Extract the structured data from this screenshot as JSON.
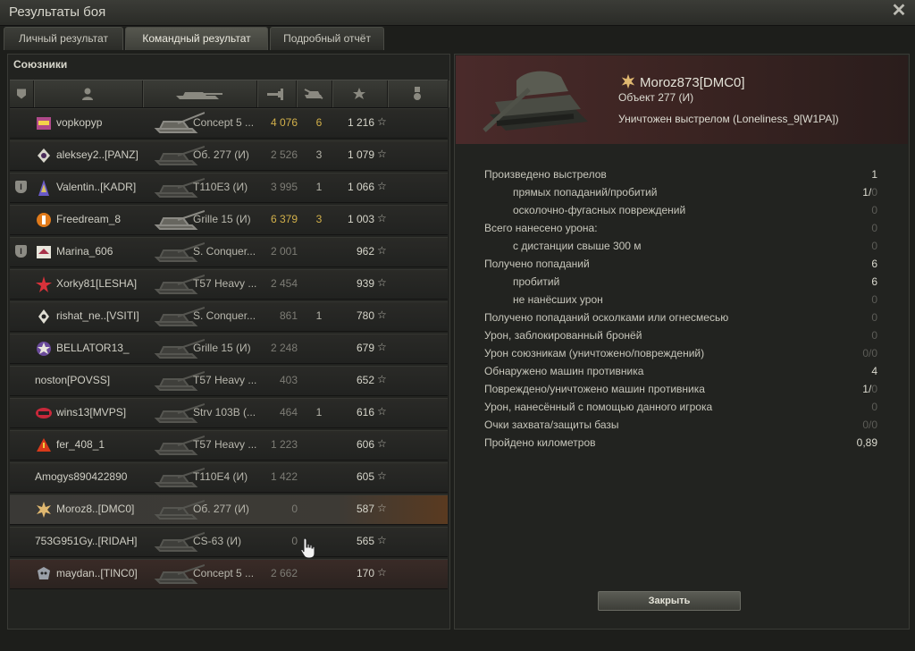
{
  "window": {
    "title": "Результаты боя"
  },
  "tabs": [
    {
      "label": "Личный результат"
    },
    {
      "label": "Командный результат"
    },
    {
      "label": "Подробный отчёт"
    }
  ],
  "allies": {
    "label": "Союзники",
    "rows": [
      {
        "player": "vopkopyp",
        "vehicle": "Concept 5 ...",
        "damage": "4 076",
        "kills": "6",
        "xp": "1 216",
        "star": "☆"
      },
      {
        "player": "aleksey2..[PANZ]",
        "vehicle": "Об. 277 (И)",
        "damage": "2 526",
        "kills": "3",
        "xp": "1 079",
        "star": "☆"
      },
      {
        "player": "Valentin..[KADR]",
        "vehicle": "T110E3 (И)",
        "damage": "3 995",
        "kills": "1",
        "xp": "1 066",
        "star": "☆"
      },
      {
        "player": "Freedream_8",
        "vehicle": "Grille 15 (И)",
        "damage": "6 379",
        "kills": "3",
        "xp": "1 003",
        "star": "☆"
      },
      {
        "player": "Marina_606",
        "vehicle": "S. Conquer...",
        "damage": "2 001",
        "kills": "",
        "xp": "962",
        "star": "☆"
      },
      {
        "player": "Xorky81[LESHA]",
        "vehicle": "T57 Heavy ...",
        "damage": "2 454",
        "kills": "",
        "xp": "939",
        "star": "☆"
      },
      {
        "player": "rishat_ne..[VSITI]",
        "vehicle": "S. Conquer...",
        "damage": "861",
        "kills": "1",
        "xp": "780",
        "star": "☆"
      },
      {
        "player": "BELLATOR13_",
        "vehicle": "Grille 15 (И)",
        "damage": "2 248",
        "kills": "",
        "xp": "679",
        "star": "☆"
      },
      {
        "player": "noston[POVSS]",
        "vehicle": "T57 Heavy ...",
        "damage": "403",
        "kills": "",
        "xp": "652",
        "star": "☆"
      },
      {
        "player": "wins13[MVPS]",
        "vehicle": "Strv 103B (...",
        "damage": "464",
        "kills": "1",
        "xp": "616",
        "star": "☆"
      },
      {
        "player": "fer_408_1",
        "vehicle": "T57 Heavy ...",
        "damage": "1 223",
        "kills": "",
        "xp": "606",
        "star": "☆"
      },
      {
        "player": "Amogys890422890",
        "vehicle": "T110E4 (И)",
        "damage": "1 422",
        "kills": "",
        "xp": "605",
        "star": "☆"
      },
      {
        "player": "Moroz8..[DMC0]",
        "vehicle": "Об. 277 (И)",
        "damage": "0",
        "kills": "",
        "xp": "587",
        "star": "☆"
      },
      {
        "player": "753G951Gy..[RIDAH]",
        "vehicle": "CS-63 (И)",
        "damage": "0",
        "kills": "",
        "xp": "565",
        "star": "☆"
      },
      {
        "player": "maydan..[TINC0]",
        "vehicle": "Concept 5 ...",
        "damage": "2 662",
        "kills": "",
        "xp": "170",
        "star": "☆"
      }
    ]
  },
  "detail": {
    "player": "Moroz873[DMC0]",
    "vehicle": "Объект 277 (И)",
    "destroyed_by": "Уничтожен выстрелом (Loneliness_9[W1PA])",
    "stats": [
      {
        "label": "Произведено выстрелов",
        "value": "1"
      },
      {
        "label": "прямых попаданий/пробитий",
        "value": "1/",
        "value2": "0"
      },
      {
        "label": "осколочно-фугасных повреждений",
        "value": "0"
      },
      {
        "label": "Всего нанесено урона:",
        "value": "0"
      },
      {
        "label": "с дистанции свыше 300 м",
        "value": "0"
      },
      {
        "label": "Получено попаданий",
        "value": "6"
      },
      {
        "label": "пробитий",
        "value": "6"
      },
      {
        "label": "не нанёсших урон",
        "value": "0"
      },
      {
        "label": "Получено попаданий осколками или огнесмесью",
        "value": "0"
      },
      {
        "label": "Урон, заблокированный бронёй",
        "value": "0"
      },
      {
        "label": "Урон союзникам (уничтожено/повреждений)",
        "value": "0/0"
      },
      {
        "label": "Обнаружено машин противника",
        "value": "4"
      },
      {
        "label": "Повреждено/уничтожено машин противника",
        "value": "1/",
        "value2": "0"
      },
      {
        "label": "Урон, нанесённый с помощью данного игрока",
        "value": "0"
      },
      {
        "label": "Очки захвата/защиты базы",
        "value": "0/0"
      },
      {
        "label": "Пройдено километров",
        "value": "0,89"
      }
    ],
    "close_label": "Закрыть"
  }
}
